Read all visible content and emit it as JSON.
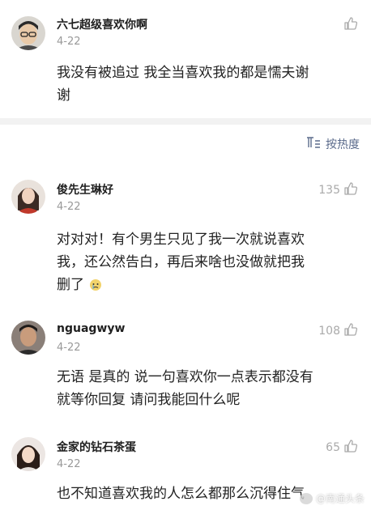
{
  "sort": {
    "label": "按热度",
    "icon": "sort-icon"
  },
  "comments": [
    {
      "username": "六七超级喜欢你啊",
      "date": "4-22",
      "likes": "",
      "text_lines": [
        "我没有被追过 我全当喜欢我的都是懦夫谢",
        "谢"
      ],
      "avatar": "avatar-man-glasses"
    },
    {
      "username": "俊先生琳好",
      "date": "4-22",
      "likes": "135",
      "text_lines": [
        "对对对！有个男生只见了我一次就说喜欢",
        "我，还公然告白，再后来啥也没做就把我",
        "删了"
      ],
      "avatar": "avatar-woman-red"
    },
    {
      "username": "nguagwyw",
      "date": "4-22",
      "likes": "108",
      "text_lines": [
        "无语 是真的 说一句喜欢你一点表示都没有",
        "就等你回复 请问我能回什么呢"
      ],
      "avatar": "avatar-man-dark"
    },
    {
      "username": "金家的钻石茶蛋",
      "date": "4-22",
      "likes": "65",
      "text_lines": [
        "也不知道喜欢我的人怎么都那么沉得住气"
      ],
      "avatar": "avatar-woman-hair"
    }
  ],
  "watermark": {
    "text": "@南通头条",
    "icon": "weibo-icon"
  }
}
